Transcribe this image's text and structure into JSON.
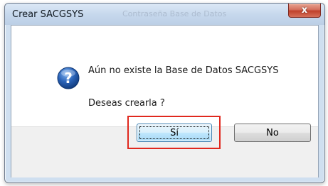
{
  "window": {
    "title": "Crear SACGSYS",
    "background_title": "Contraseña Base de Datos"
  },
  "dialog": {
    "icon": "question-icon",
    "message": "Aún no existe la Base de Datos SACGSYS",
    "question": "Deseas crearla ?"
  },
  "buttons": {
    "yes_label": "Sí",
    "no_label": "No",
    "close_glyph": "x",
    "default_button": "Sí"
  },
  "colors": {
    "highlight": "#e0281e",
    "icon": "#2a63b8"
  }
}
